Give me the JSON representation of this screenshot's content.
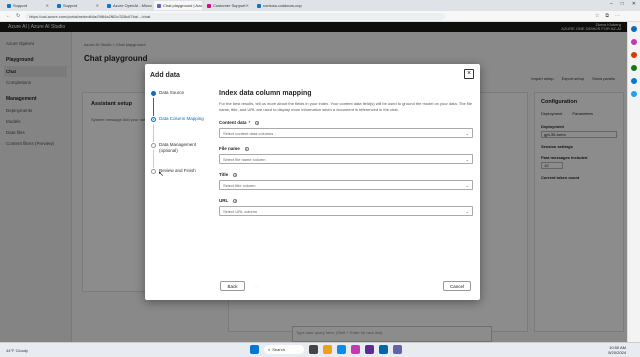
{
  "browser": {
    "tabs": [
      {
        "label": "Support",
        "color": "#0078d4",
        "active": false
      },
      {
        "label": "Support",
        "color": "#0078d4",
        "active": false
      },
      {
        "label": "Azure OpenAI - Microsoft Azure",
        "color": "#0078d4",
        "active": false
      },
      {
        "label": "Chat playground | Azure AI Stu",
        "color": "#5b5fc7",
        "active": true
      },
      {
        "label": "Customer Support",
        "color": "#e3008c",
        "active": false
      },
      {
        "label": "contoso-outdoors-copilot - Azu",
        "color": "#0078d4",
        "active": false
      }
    ],
    "url": "https://oai.azure.com/portal/aeded64a/0984a2f82c/328c67ba/.../chat"
  },
  "portal": {
    "brand": "Azure AI | Azure AI Studio",
    "user_line1": "Diana Kloberg",
    "user_line2": "AZURE ONE DEMOS FOR AZ-AI",
    "left_nav": {
      "top_item": "Azure OpenAI",
      "sections": [
        {
          "title": "Playground",
          "items": [
            "Chat",
            "Completions"
          ]
        },
        {
          "title": "Management",
          "items": [
            "Deployments",
            "Models",
            "Data files",
            "Content filters (Preview)"
          ]
        }
      ]
    },
    "breadcrumb": "Azure AI Studio  >  Chat playground",
    "page_title": "Chat playground",
    "toolbar": [
      "Import setup",
      "Export setup",
      "Show panels"
    ],
    "assistant_setup": {
      "title": "Assistant setup",
      "text": "System message   Add your data   Add a data source"
    },
    "chat_input_placeholder": "Type user query here. (Shift + Enter for new line)",
    "configuration": {
      "title": "Configuration",
      "tabs": [
        "Deployment",
        "Parameters"
      ],
      "deployment_label": "Deployment",
      "deployment_value": "gpt-35-turbo",
      "session_label": "Session settings",
      "past_messages_label": "Past messages included",
      "past_messages_value": "10",
      "current_tokens_label": "Current token count"
    }
  },
  "modal": {
    "title": "Add data",
    "close_glyph": "×",
    "steps": [
      {
        "label": "Data Source",
        "state": "done"
      },
      {
        "label": "Data Column Mapping",
        "state": "current"
      },
      {
        "label": "Data Management (optional)",
        "state": "upcoming"
      },
      {
        "label": "Review and Finish",
        "state": "upcoming"
      }
    ],
    "heading": "Index data column mapping",
    "description": "For the best results, tell us more about the fields in your index. Your content data field(s) will be used to ground the model on your data. The file name, title, and URL are used to display more information when a document is referenced in the chat.",
    "fields": [
      {
        "label": "Content data",
        "required": true,
        "placeholder": "Select content data columns"
      },
      {
        "label": "File name",
        "required": false,
        "placeholder": "Select file name column"
      },
      {
        "label": "Title",
        "required": false,
        "placeholder": "Select title column"
      },
      {
        "label": "URL",
        "required": false,
        "placeholder": "Select URL column"
      }
    ],
    "back_label": "Back",
    "next_label": "...",
    "cancel_label": "Cancel"
  },
  "taskbar": {
    "weather": "44°F Cloudy",
    "search_label": "Search",
    "time": "10:50 AM",
    "date": "5/20/2024"
  }
}
